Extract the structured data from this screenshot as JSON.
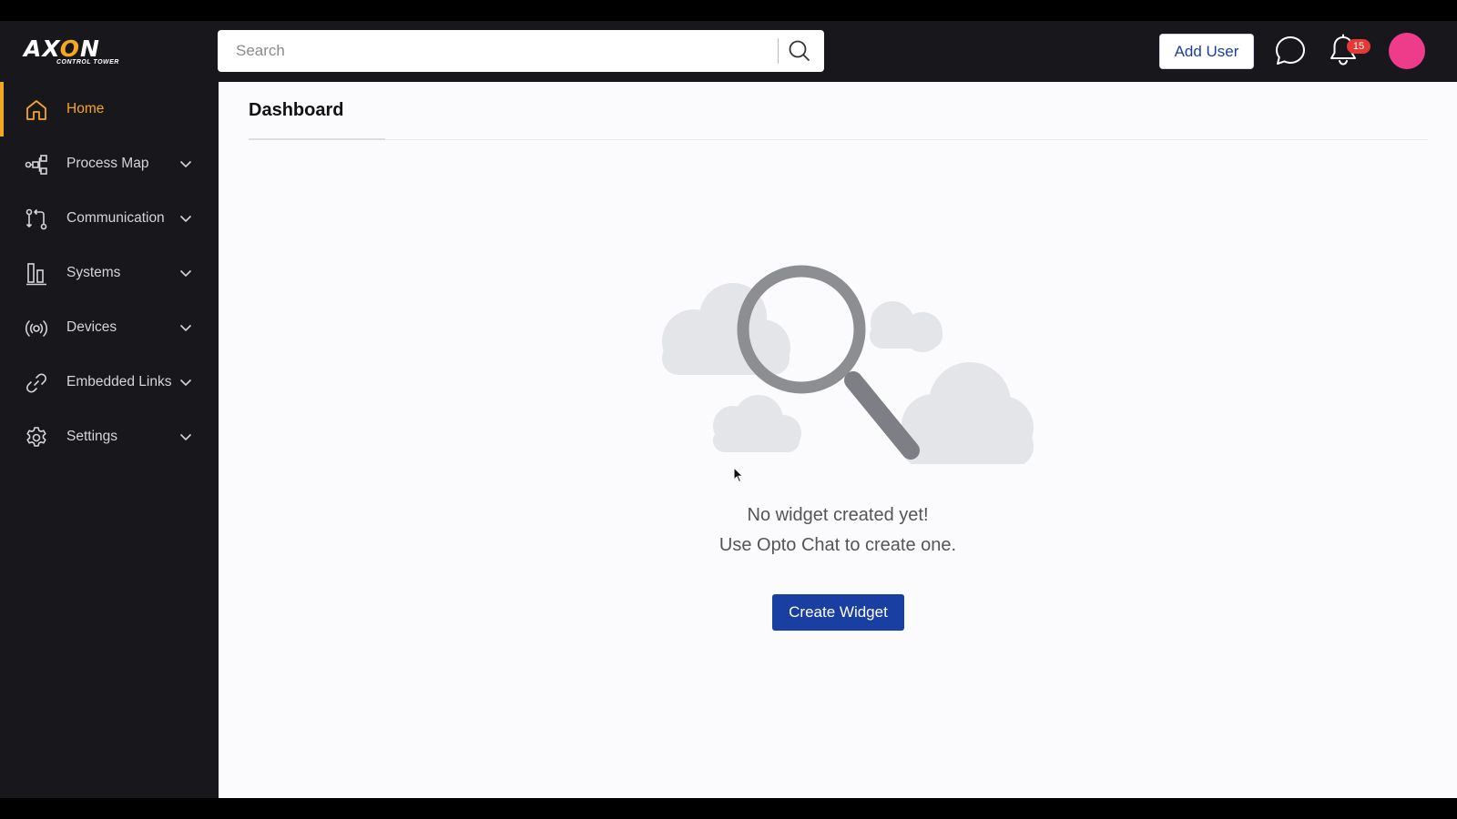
{
  "brand": {
    "name_prefix": "AX",
    "name_o": "O",
    "name_suffix": "N",
    "tagline": "CONTROL TOWER",
    "accent": "#f5a623"
  },
  "header": {
    "search": {
      "placeholder": "Search",
      "value": ""
    },
    "add_user_label": "Add User",
    "notifications_count": "15",
    "avatar_color": "#ee3c8b"
  },
  "sidebar": {
    "items": [
      {
        "label": "Home",
        "icon": "home-icon",
        "active": true
      },
      {
        "label": "Process Map",
        "icon": "process-map-icon"
      },
      {
        "label": "Communication",
        "icon": "communication-icon"
      },
      {
        "label": "Systems",
        "icon": "systems-icon"
      },
      {
        "label": "Devices",
        "icon": "devices-icon"
      },
      {
        "label": "Embedded Links",
        "icon": "link-icon"
      },
      {
        "label": "Settings",
        "icon": "gear-icon"
      }
    ]
  },
  "main": {
    "title": "Dashboard",
    "empty_line1": "No widget created yet!",
    "empty_line2": "Use Opto Chat to create one.",
    "create_label": "Create Widget",
    "primary_color": "#1a3fa3"
  }
}
